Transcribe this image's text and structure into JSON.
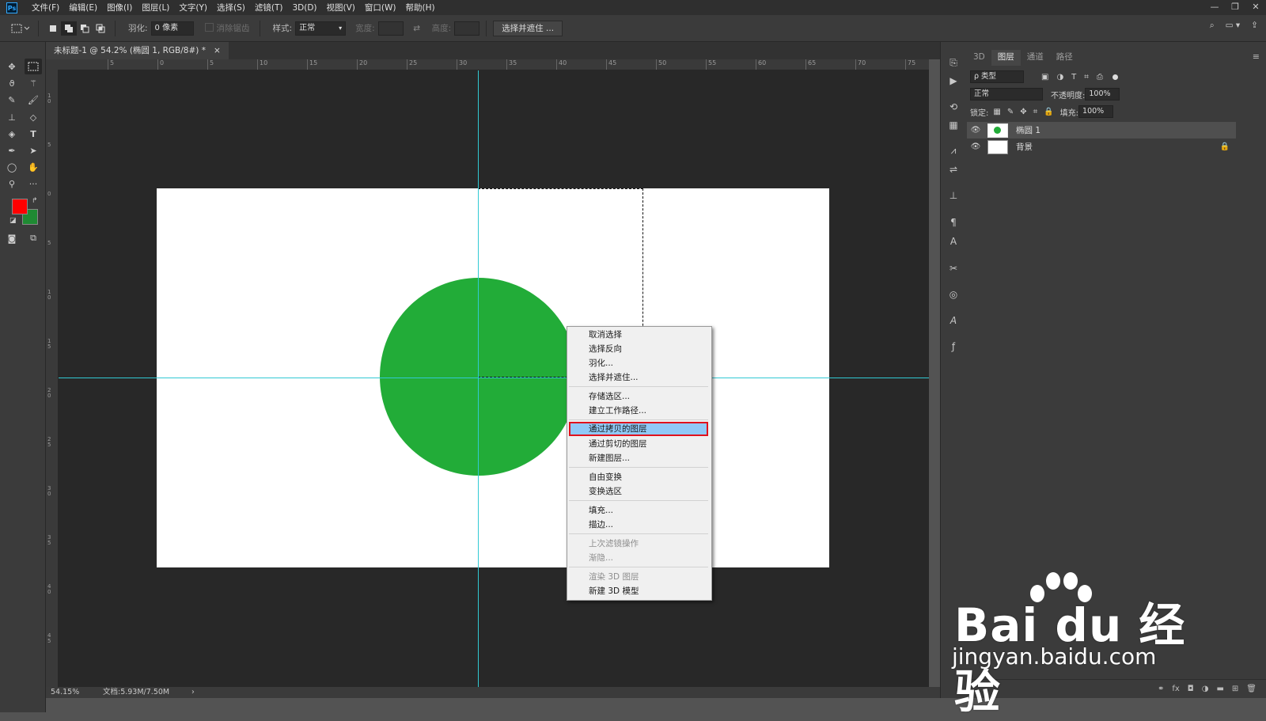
{
  "app": {
    "logo": "Ps"
  },
  "menu": [
    "文件(F)",
    "编辑(E)",
    "图像(I)",
    "图层(L)",
    "文字(Y)",
    "选择(S)",
    "滤镜(T)",
    "3D(D)",
    "视图(V)",
    "窗口(W)",
    "帮助(H)"
  ],
  "window_controls": [
    "—",
    "❐",
    "✕"
  ],
  "options": {
    "feather_label": "羽化:",
    "feather_value": "0 像素",
    "antialias_label": "消除锯齿",
    "style_label": "样式:",
    "style_value": "正常",
    "width_label": "宽度:",
    "height_label": "高度:",
    "select_mask_button": "选择并遮住 ..."
  },
  "document_tab": {
    "title": "未标题-1 @ 54.2% (椭圆 1, RGB/8#) *",
    "close": "×"
  },
  "ruler_top": [
    "5",
    "0",
    "5",
    "10",
    "15",
    "20",
    "25",
    "30",
    "35",
    "40",
    "45",
    "50",
    "55",
    "60",
    "65",
    "70",
    "75"
  ],
  "ruler_left": [
    "1 0",
    "5",
    "0",
    "5",
    "1 0",
    "1 5",
    "2 0",
    "2 5",
    "3 0",
    "3 5",
    "4 0",
    "4 5"
  ],
  "colors": {
    "foreground": "#ff0000",
    "background": "#1f8a33",
    "circle": "#22ac38",
    "guide": "#32c9d3",
    "highlight": "#91c9f7",
    "highlight_border": "#e0121d"
  },
  "context_menu": [
    {
      "label": "取消选择",
      "disabled": false
    },
    {
      "label": "选择反向",
      "disabled": false
    },
    {
      "label": "羽化...",
      "disabled": false
    },
    {
      "label": "选择并遮住...",
      "disabled": false
    },
    {
      "label": "存储选区...",
      "disabled": false
    },
    {
      "label": "建立工作路径...",
      "disabled": false
    },
    {
      "label": "通过拷贝的图层",
      "disabled": false,
      "highlighted": true
    },
    {
      "label": "通过剪切的图层",
      "disabled": false
    },
    {
      "label": "新建图层...",
      "disabled": false
    },
    {
      "label": "自由变换",
      "disabled": false
    },
    {
      "label": "变换选区",
      "disabled": false
    },
    {
      "label": "填充...",
      "disabled": false
    },
    {
      "label": "描边...",
      "disabled": false
    },
    {
      "label": "上次滤镜操作",
      "disabled": true
    },
    {
      "label": "渐隐...",
      "disabled": true
    },
    {
      "label": "渲染 3D 图层",
      "disabled": true
    },
    {
      "label": "新建 3D 模型",
      "disabled": false
    }
  ],
  "status": {
    "zoom": "54.15%",
    "doc": "文档:5.93M/7.50M",
    "arrow": "›"
  },
  "panel": {
    "tabs": [
      "3D",
      "图层",
      "通道",
      "路径"
    ],
    "active_tab": "图层",
    "filter_label": "ρ 类型",
    "blend_mode": "正常",
    "opacity_label": "不透明度:",
    "opacity_value": "100%",
    "lock_label": "锁定:",
    "fill_label": "填充:",
    "fill_value": "100%",
    "layers": [
      {
        "name": "椭圆 1",
        "selected": true
      },
      {
        "name": "背景",
        "selected": false,
        "locked": true
      }
    ]
  },
  "watermark": {
    "brand": "Bai du 经验",
    "url": "jingyan.baidu.com"
  }
}
